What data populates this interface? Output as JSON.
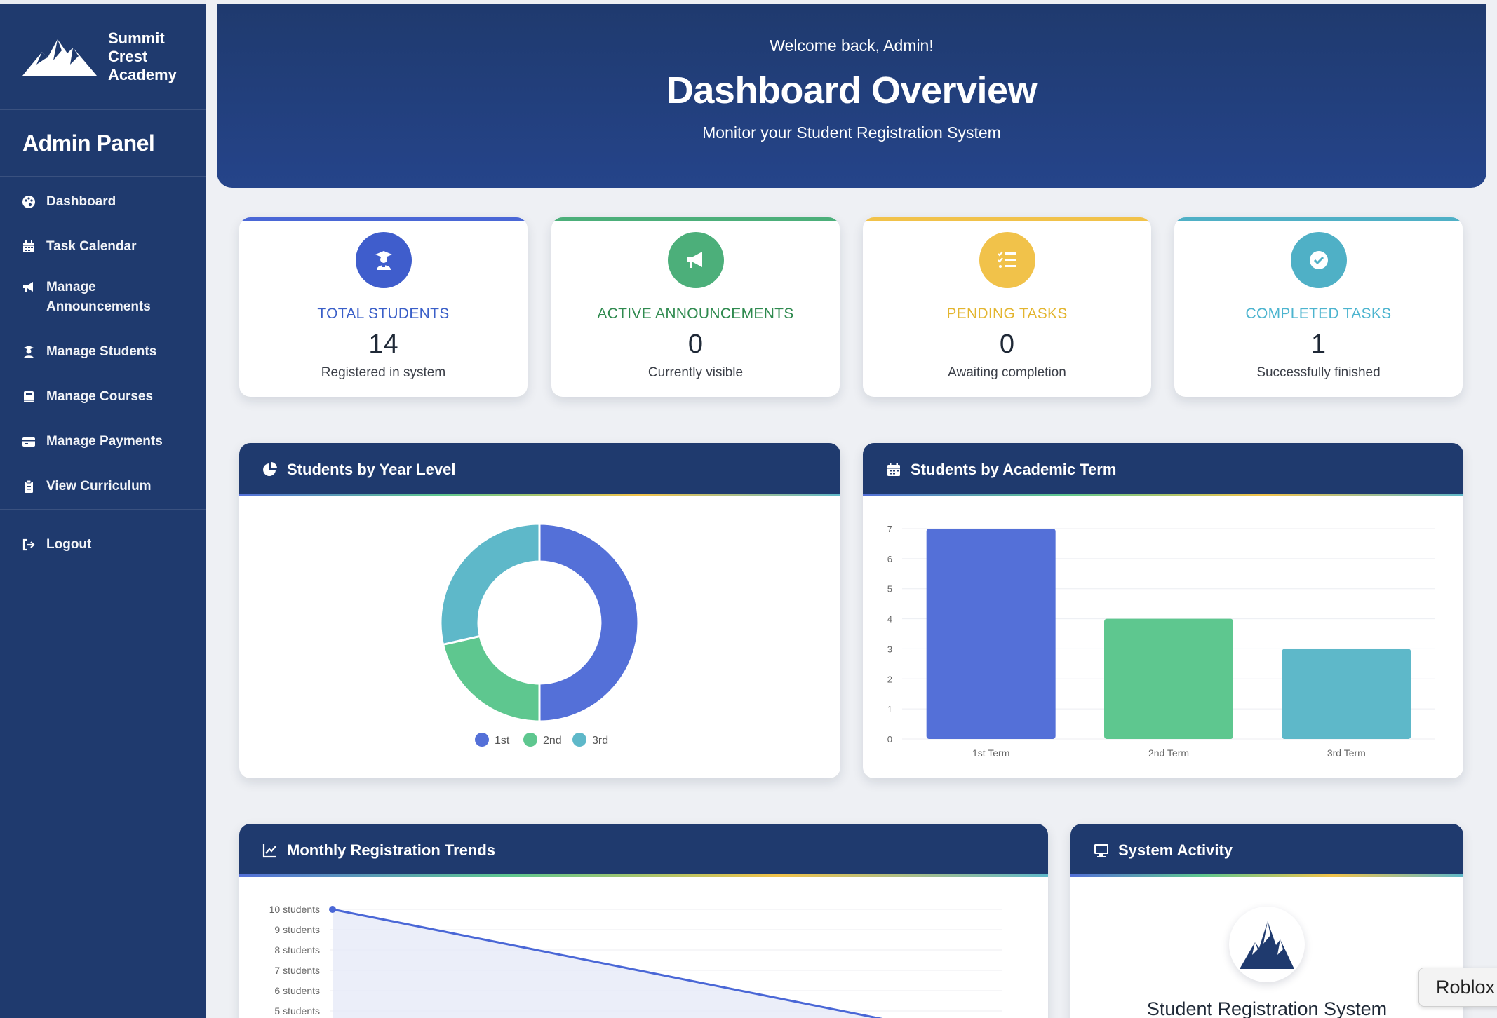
{
  "sidebar": {
    "brand_name": [
      "Summit",
      "Crest",
      "Academy"
    ],
    "panel_title": "Admin Panel",
    "items": [
      {
        "label": "Dashboard",
        "icon": "palette-icon"
      },
      {
        "label": "Task Calendar",
        "icon": "calendar-icon"
      },
      {
        "label": "Manage Announcements",
        "icon": "megaphone-icon"
      },
      {
        "label": "Manage Students",
        "icon": "student-icon"
      },
      {
        "label": "Manage Courses",
        "icon": "book-icon"
      },
      {
        "label": "Manage Payments",
        "icon": "credit-card-icon"
      },
      {
        "label": "View Curriculum",
        "icon": "clipboard-icon"
      }
    ],
    "logout_label": "Logout"
  },
  "hero": {
    "welcome": "Welcome back, Admin!",
    "title": "Dashboard Overview",
    "subtitle": "Monitor your Student Registration System"
  },
  "stats": [
    {
      "label": "TOTAL STUDENTS",
      "value": "14",
      "desc": "Registered in system",
      "color": "#4a67d6",
      "label_color": "#3a5fc8",
      "icon": "graduate-icon"
    },
    {
      "label": "ACTIVE ANNOUNCEMENTS",
      "value": "0",
      "desc": "Currently visible",
      "color": "#4caf7a",
      "label_color": "#2f8a4f",
      "icon": "megaphone-icon"
    },
    {
      "label": "PENDING TASKS",
      "value": "0",
      "desc": "Awaiting completion",
      "color": "#f1c24a",
      "label_color": "#e3b52f",
      "icon": "tasks-icon"
    },
    {
      "label": "COMPLETED TASKS",
      "value": "1",
      "desc": "Successfully finished",
      "color": "#4fb0c6",
      "label_color": "#4cb4cf",
      "icon": "check-circle-icon"
    }
  ],
  "cards": {
    "year_level_title": "Students by Year Level",
    "term_title": "Students by Academic Term",
    "monthly_title": "Monthly Registration Trends",
    "activity_title": "System Activity",
    "activity_heading": "Student Registration System"
  },
  "chart_data": [
    {
      "type": "pie",
      "variant": "donut",
      "categories": [
        "1st",
        "2nd",
        "3rd"
      ],
      "values": [
        7,
        3,
        4
      ],
      "colors": [
        "#5470d8",
        "#5ec78f",
        "#5eb8c9"
      ],
      "legend": "bottom"
    },
    {
      "type": "bar",
      "categories": [
        "1st Term",
        "2nd Term",
        "3rd Term"
      ],
      "values": [
        7,
        4,
        3
      ],
      "colors": [
        "#5470d8",
        "#5ec78f",
        "#5eb8c9"
      ],
      "ylim": [
        0,
        7
      ],
      "yticks": [
        "0",
        "1",
        "2",
        "3",
        "4",
        "5",
        "6",
        "7"
      ],
      "grid": true
    },
    {
      "type": "line",
      "yticks": [
        "10 students",
        "9 students",
        "8 students",
        "7 students",
        "6 students",
        "5 students"
      ],
      "series": [
        {
          "values": [
            10,
            4
          ]
        }
      ],
      "color": "#4a67d6",
      "fill": "#e6eaf8"
    }
  ],
  "tooltip": "Roblox",
  "colors": {
    "navy": "#1f3a6e"
  }
}
